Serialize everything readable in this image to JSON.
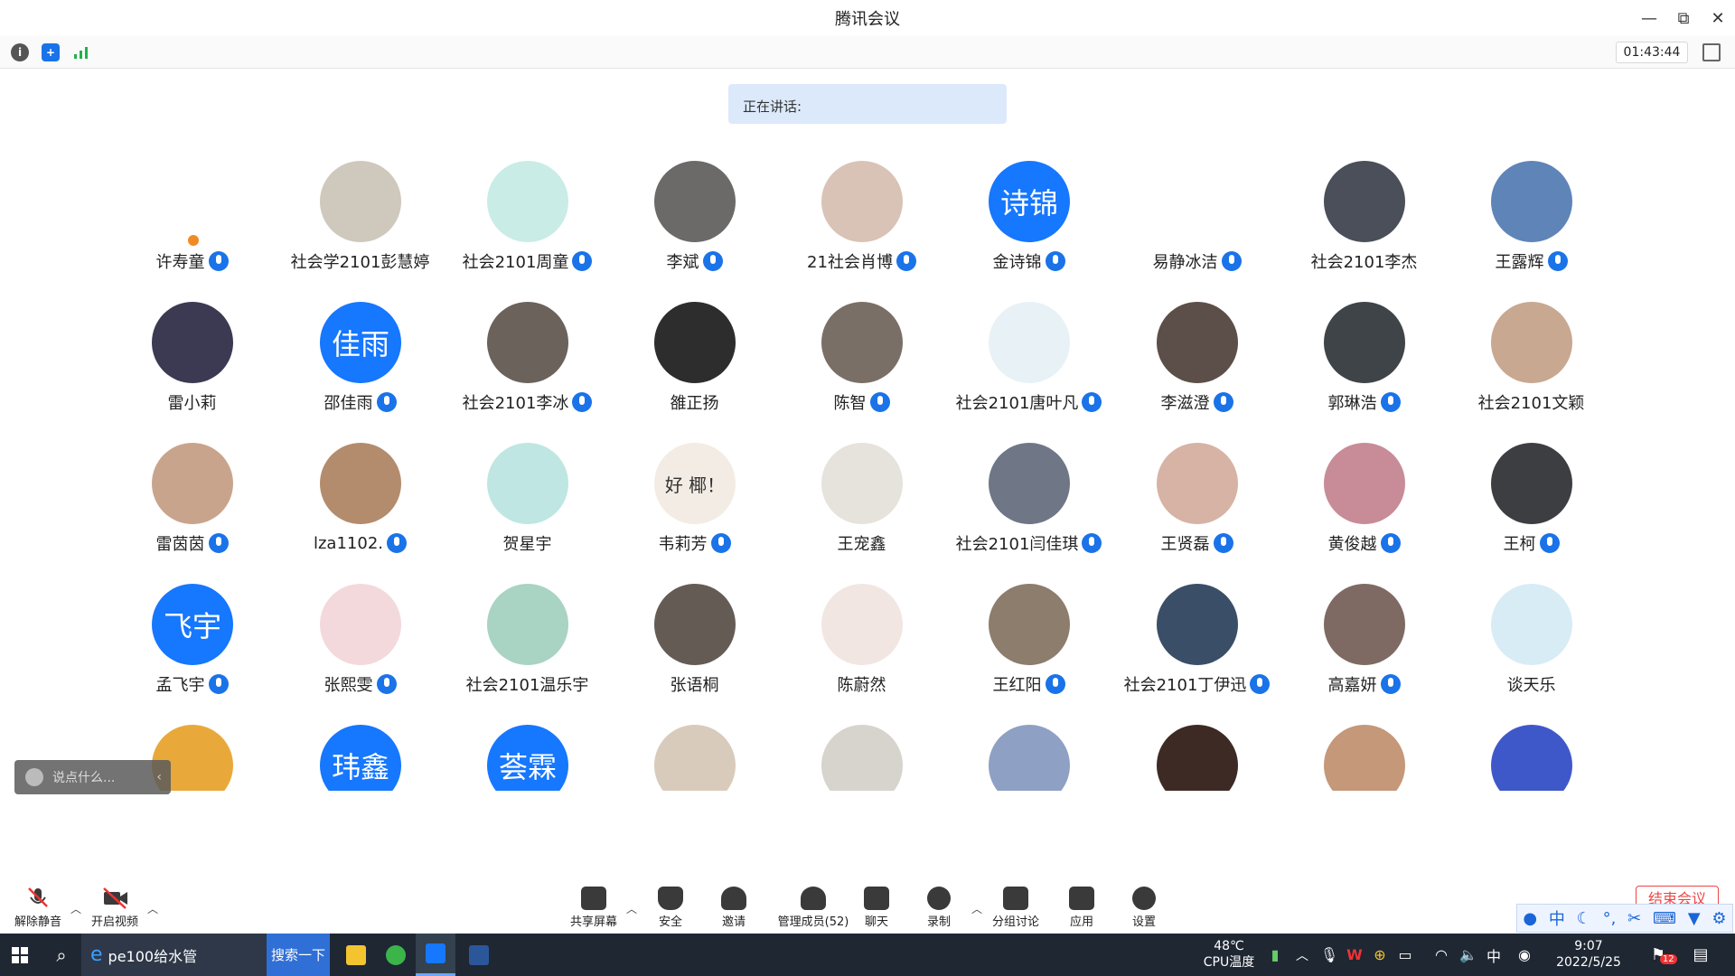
{
  "window": {
    "title": "腾讯会议",
    "controls": [
      "—",
      "⧉",
      "✕"
    ]
  },
  "infobar": {
    "timer": "01:43:44"
  },
  "speaking": {
    "label": "正在讲话:"
  },
  "participants": [
    {
      "name": "许寿童",
      "mic": true,
      "host": true,
      "avatar_color": "#ffffff",
      "avatar_text": "",
      "kind": "logo"
    },
    {
      "name": "社会学2101彭慧婷",
      "mic": false,
      "avatar_color": "#cfc8bc",
      "avatar_text": ""
    },
    {
      "name": "社会2101周童",
      "mic": true,
      "avatar_color": "#c9ece7",
      "avatar_text": ""
    },
    {
      "name": "李斌",
      "mic": true,
      "avatar_color": "#6c6a68",
      "avatar_text": ""
    },
    {
      "name": "21社会肖博",
      "mic": true,
      "avatar_color": "#d9c3b6",
      "avatar_text": ""
    },
    {
      "name": "金诗锦",
      "mic": true,
      "avatar_color": "#1677ff",
      "avatar_text": "诗锦"
    },
    {
      "name": "易静冰洁",
      "mic": true,
      "avatar_color": "#ffffff",
      "avatar_text": ""
    },
    {
      "name": "社会2101李杰",
      "mic": false,
      "avatar_color": "#4a4f59",
      "avatar_text": ""
    },
    {
      "name": "王露辉",
      "mic": true,
      "avatar_color": "#5f84b8",
      "avatar_text": ""
    },
    {
      "name": "雷小莉",
      "mic": false,
      "avatar_color": "#3b3a52",
      "avatar_text": ""
    },
    {
      "name": "邵佳雨",
      "mic": true,
      "avatar_color": "#1677ff",
      "avatar_text": "佳雨"
    },
    {
      "name": "社会2101李冰",
      "mic": true,
      "avatar_color": "#6b625c",
      "avatar_text": ""
    },
    {
      "name": "雒正扬",
      "mic": false,
      "avatar_color": "#2d2d2d",
      "avatar_text": ""
    },
    {
      "name": "陈智",
      "mic": true,
      "avatar_color": "#7a6f66",
      "avatar_text": ""
    },
    {
      "name": "社会2101唐叶凡",
      "mic": true,
      "avatar_color": "#e8f2f6",
      "avatar_text": ""
    },
    {
      "name": "李滋澄",
      "mic": true,
      "avatar_color": "#5c4e48",
      "avatar_text": ""
    },
    {
      "name": "郭琳浩",
      "mic": true,
      "avatar_color": "#3e4448",
      "avatar_text": ""
    },
    {
      "name": "社会2101文颖",
      "mic": false,
      "avatar_color": "#c8a891",
      "avatar_text": ""
    },
    {
      "name": "雷茵茵",
      "mic": true,
      "avatar_color": "#c9a48c",
      "avatar_text": ""
    },
    {
      "name": "lza1102.",
      "mic": true,
      "avatar_color": "#b38c6d",
      "avatar_text": ""
    },
    {
      "name": "贺星宇",
      "mic": false,
      "avatar_color": "#bfe6e2",
      "avatar_text": ""
    },
    {
      "name": "韦莉芳",
      "mic": true,
      "avatar_color": "#f3ece4",
      "avatar_text": "好 椰！"
    },
    {
      "name": "王宠鑫",
      "mic": false,
      "avatar_color": "#e6e2dc",
      "avatar_text": ""
    },
    {
      "name": "社会2101闫佳琪",
      "mic": true,
      "avatar_color": "#6f7686",
      "avatar_text": ""
    },
    {
      "name": "王贤磊",
      "mic": true,
      "avatar_color": "#d6b3a5",
      "avatar_text": ""
    },
    {
      "name": "黄俊越",
      "mic": true,
      "avatar_color": "#c78c98",
      "avatar_text": ""
    },
    {
      "name": "王柯",
      "mic": true,
      "avatar_color": "#3c3e42",
      "avatar_text": ""
    },
    {
      "name": "孟飞宇",
      "mic": true,
      "avatar_color": "#1677ff",
      "avatar_text": "飞宇"
    },
    {
      "name": "张熙雯",
      "mic": true,
      "avatar_color": "#f3d9dc",
      "avatar_text": ""
    },
    {
      "name": "社会2101温乐宇",
      "mic": false,
      "avatar_color": "#a9d3c3",
      "avatar_text": ""
    },
    {
      "name": "张语桐",
      "mic": false,
      "avatar_color": "#655b55",
      "avatar_text": ""
    },
    {
      "name": "陈蔚然",
      "mic": false,
      "avatar_color": "#f2e6e2",
      "avatar_text": ""
    },
    {
      "name": "王红阳",
      "mic": true,
      "avatar_color": "#8d7d6d",
      "avatar_text": ""
    },
    {
      "name": "社会2101丁伊迅",
      "mic": true,
      "avatar_color": "#3a4e68",
      "avatar_text": ""
    },
    {
      "name": "高嘉妍",
      "mic": true,
      "avatar_color": "#7e6a63",
      "avatar_text": ""
    },
    {
      "name": "谈天乐",
      "mic": false,
      "avatar_color": "#d8ecf6",
      "avatar_text": ""
    },
    {
      "name": "",
      "mic": false,
      "avatar_color": "#e8a93a",
      "avatar_text": ""
    },
    {
      "name": "",
      "mic": false,
      "avatar_color": "#1677ff",
      "avatar_text": "玮鑫"
    },
    {
      "name": "",
      "mic": false,
      "avatar_color": "#1677ff",
      "avatar_text": "荟霖"
    },
    {
      "name": "",
      "mic": false,
      "avatar_color": "#d9cbbb",
      "avatar_text": ""
    },
    {
      "name": "",
      "mic": false,
      "avatar_color": "#d7d3cd",
      "avatar_text": ""
    },
    {
      "name": "",
      "mic": false,
      "avatar_color": "#8ea0c3",
      "avatar_text": ""
    },
    {
      "name": "",
      "mic": false,
      "avatar_color": "#3d2a24",
      "avatar_text": ""
    },
    {
      "name": "",
      "mic": false,
      "avatar_color": "#c49879",
      "avatar_text": ""
    },
    {
      "name": "",
      "mic": false,
      "avatar_color": "#3f58c9",
      "avatar_text": ""
    }
  ],
  "chat": {
    "placeholder": "说点什么..."
  },
  "toolbar": {
    "unmute": "解除静音",
    "start_video": "开启视频",
    "share": "共享屏幕",
    "security": "安全",
    "invite": "邀请",
    "members": "管理成员(52)",
    "chat": "聊天",
    "record": "录制",
    "breakout": "分组讨论",
    "apps": "应用",
    "settings": "设置",
    "end": "结束会议"
  },
  "ime": {
    "lang": "中"
  },
  "taskbar": {
    "browser_tab": "pe100给水管",
    "search_btn": "搜索一下",
    "temp": "48℃",
    "temp_label": "CPU温度",
    "ime_lang": "中",
    "time": "9:07",
    "date": "2022/5/25",
    "notif_count": "12"
  },
  "colors": {
    "accent": "#1677ff",
    "taskbar": "#1f2733",
    "speaking_bg": "#dce9fb",
    "end_red": "#e44444"
  }
}
